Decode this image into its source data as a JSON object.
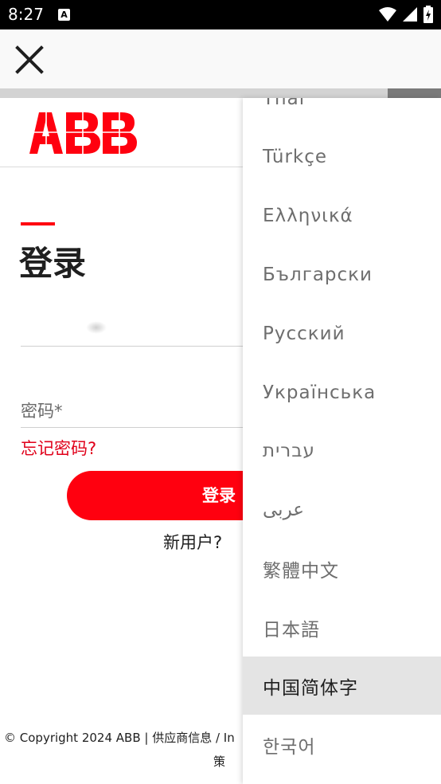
{
  "status_bar": {
    "time": "8:27",
    "notification_icon": "A"
  },
  "app_bar": {
    "close_icon": "close-icon"
  },
  "progress": {
    "fraction": 0.12
  },
  "login": {
    "title": "登录",
    "username_value": "",
    "password_placeholder": "密码*",
    "forgot_password": "忘记密码?",
    "login_button": "登录",
    "new_user": "新用户?"
  },
  "footer": {
    "line1": "© Copyright 2024 ABB | 供应商信息 / In",
    "line2": "策"
  },
  "languages": {
    "items": [
      {
        "label": "Thai"
      },
      {
        "label": "Türkçe"
      },
      {
        "label": "Ελληνικά"
      },
      {
        "label": "Български"
      },
      {
        "label": "Русский"
      },
      {
        "label": "Українська"
      },
      {
        "label": "עברית"
      },
      {
        "label": "عربى"
      },
      {
        "label": "繁體中文"
      },
      {
        "label": "日本語"
      },
      {
        "label": "中国简体字"
      },
      {
        "label": "한국어"
      }
    ],
    "selected_index": 10
  },
  "colors": {
    "brand_red": "#ff000f",
    "link_red": "#e0001a",
    "selected_bg": "#e4e4e4"
  }
}
